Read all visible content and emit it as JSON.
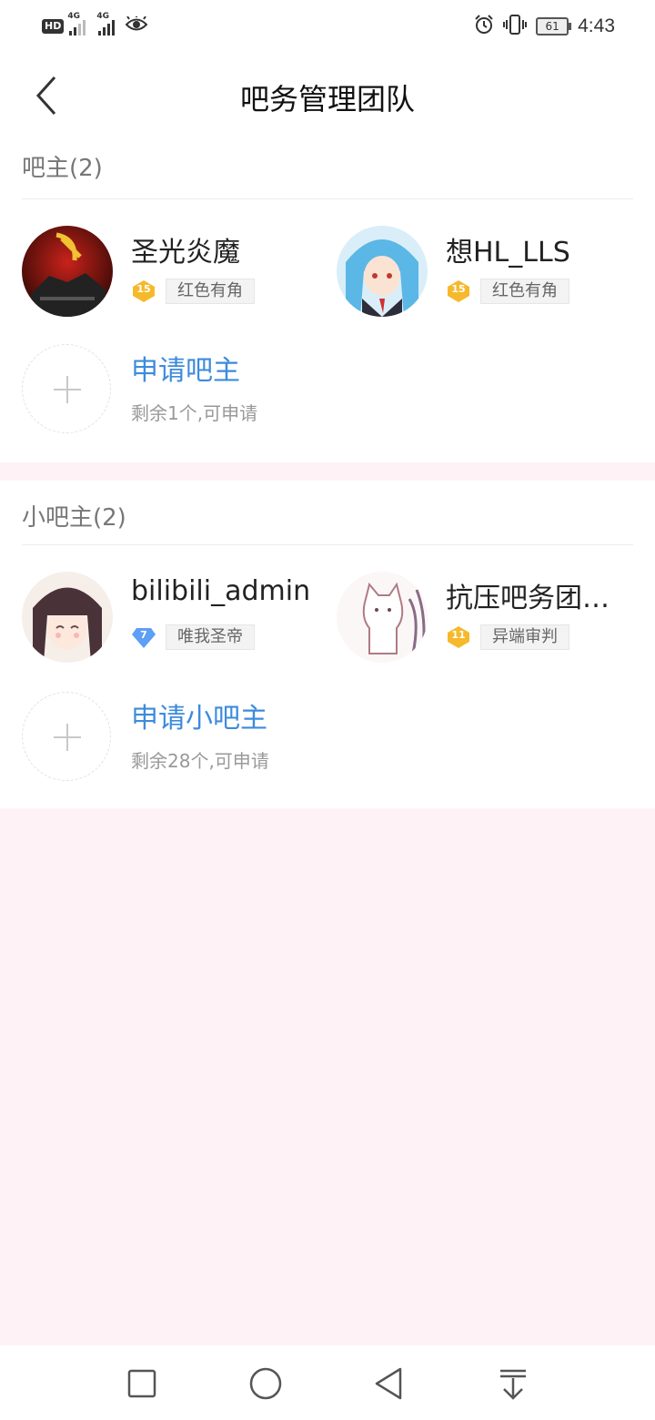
{
  "status_bar": {
    "hd_label": "HD",
    "network_1": "4G",
    "network_2": "4G",
    "battery_level": "61",
    "time": "4:43"
  },
  "header": {
    "title": "吧务管理团队"
  },
  "owners_section": {
    "header": "吧主(2)",
    "members": [
      {
        "name": "圣光炎魔",
        "level": "15",
        "title": "红色有角",
        "avatar_icon": "avatar-hammer-sickle"
      },
      {
        "name": "想HL_LLS",
        "level": "15",
        "title": "红色有角",
        "avatar_icon": "avatar-anime-girl-blue-hair"
      }
    ],
    "apply": {
      "label": "申请吧主",
      "sub": "剩余1个,可申请"
    }
  },
  "assistants_section": {
    "header": "小吧主(2)",
    "members": [
      {
        "name": "bilibili_admin",
        "level": "7",
        "title": "唯我圣帝",
        "avatar_icon": "avatar-anime-girl-brown-hair"
      },
      {
        "name": "抗压吧务团…",
        "level": "11",
        "title": "异端审判",
        "avatar_icon": "avatar-cat-sketch"
      }
    ],
    "apply": {
      "label": "申请小吧主",
      "sub": "剩余28个,可申请"
    }
  },
  "colors": {
    "accent_blue": "#3d8bdc",
    "badge_gold": "#f6b92b",
    "badge_blue": "#5c9ff5",
    "page_bg": "#fff2f6"
  }
}
